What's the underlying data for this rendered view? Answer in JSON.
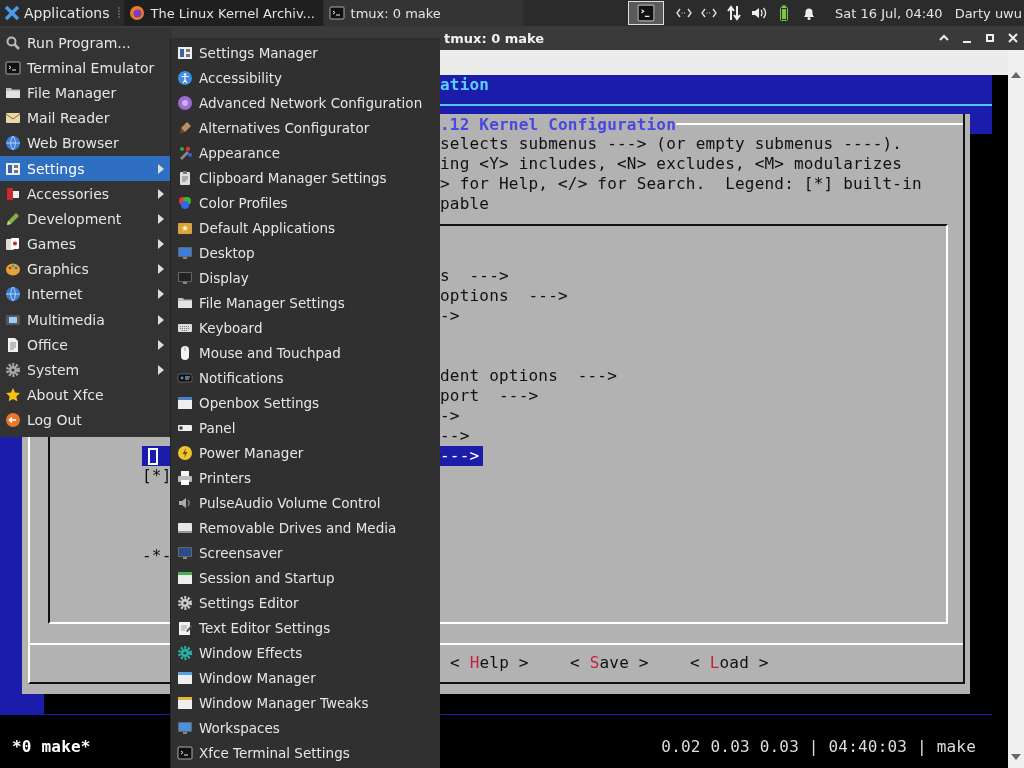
{
  "top_panel": {
    "menu_button": "Applications",
    "tasks": [
      {
        "title": "The Linux Kernel Archiv...",
        "kind": "browser",
        "selected": false
      },
      {
        "title": "tmux: 0 make",
        "kind": "terminal",
        "selected": true
      }
    ],
    "clock": "Sat 16 Jul, 04:40",
    "user": "Darty uwu"
  },
  "window": {
    "title": "tmux: 0 make"
  },
  "menuconfig": {
    "header": "ation",
    "dialog_title": ".12 Kernel Configuration",
    "help_lines": [
      "selects submenus ---> (or empty submenus ----).",
      "ing <Y> includes, <N> excludes, <M> modularizes",
      "> for Help, </> for Search.  Legend: [*] built-in",
      "pable"
    ],
    "rows": [
      {
        "tail": "s  --->",
        "selected": false
      },
      {
        "tail": "options  --->",
        "selected": false
      },
      {
        "tail": "->",
        "selected": false
      },
      {
        "tail": "dent options  --->",
        "selected": false
      },
      {
        "tail": "port  --->",
        "selected": false
      },
      {
        "tail": "->",
        "selected": false
      },
      {
        "tail": "-->",
        "selected": false
      },
      {
        "tail": "--->",
        "selected": true
      },
      {
        "lead": "[*]",
        "selected": false
      },
      {
        "lead": "-*-",
        "selected": false
      }
    ],
    "buttons": [
      {
        "before": "< ",
        "hotkey": "H",
        "after": "elp >"
      },
      {
        "before": "< ",
        "hotkey": "S",
        "after": "ave >"
      },
      {
        "before": "< ",
        "hotkey": "L",
        "after": "oad >"
      }
    ]
  },
  "tmux_status": {
    "left": "*0 make*",
    "right": "0.02 0.03 0.03 | 04:40:03 | make"
  },
  "app_menu": {
    "items": [
      {
        "label": "Run Program...",
        "has_submenu": false,
        "selected": false
      },
      {
        "label": "Terminal Emulator",
        "has_submenu": false,
        "selected": false
      },
      {
        "label": "File Manager",
        "has_submenu": false,
        "selected": false
      },
      {
        "label": "Mail Reader",
        "has_submenu": false,
        "selected": false
      },
      {
        "label": "Web Browser",
        "has_submenu": false,
        "selected": false
      },
      {
        "label": "Settings",
        "has_submenu": true,
        "selected": true
      },
      {
        "label": "Accessories",
        "has_submenu": true,
        "selected": false
      },
      {
        "label": "Development",
        "has_submenu": true,
        "selected": false
      },
      {
        "label": "Games",
        "has_submenu": true,
        "selected": false
      },
      {
        "label": "Graphics",
        "has_submenu": true,
        "selected": false
      },
      {
        "label": "Internet",
        "has_submenu": true,
        "selected": false
      },
      {
        "label": "Multimedia",
        "has_submenu": true,
        "selected": false
      },
      {
        "label": "Office",
        "has_submenu": true,
        "selected": false
      },
      {
        "label": "System",
        "has_submenu": true,
        "selected": false
      },
      {
        "label": "About Xfce",
        "has_submenu": false,
        "selected": false
      },
      {
        "label": "Log Out",
        "has_submenu": false,
        "selected": false
      }
    ]
  },
  "settings_submenu": {
    "items": [
      "Settings Manager",
      "Accessibility",
      "Advanced Network Configuration",
      "Alternatives Configurator",
      "Appearance",
      "Clipboard Manager Settings",
      "Color Profiles",
      "Default Applications",
      "Desktop",
      "Display",
      "File Manager Settings",
      "Keyboard",
      "Mouse and Touchpad",
      "Notifications",
      "Openbox Settings",
      "Panel",
      "Power Manager",
      "Printers",
      "PulseAudio Volume Control",
      "Removable Drives and Media",
      "Screensaver",
      "Session and Startup",
      "Settings Editor",
      "Text Editor Settings",
      "Window Effects",
      "Window Manager",
      "Window Manager Tweaks",
      "Workspaces",
      "Xfce Terminal Settings"
    ]
  }
}
